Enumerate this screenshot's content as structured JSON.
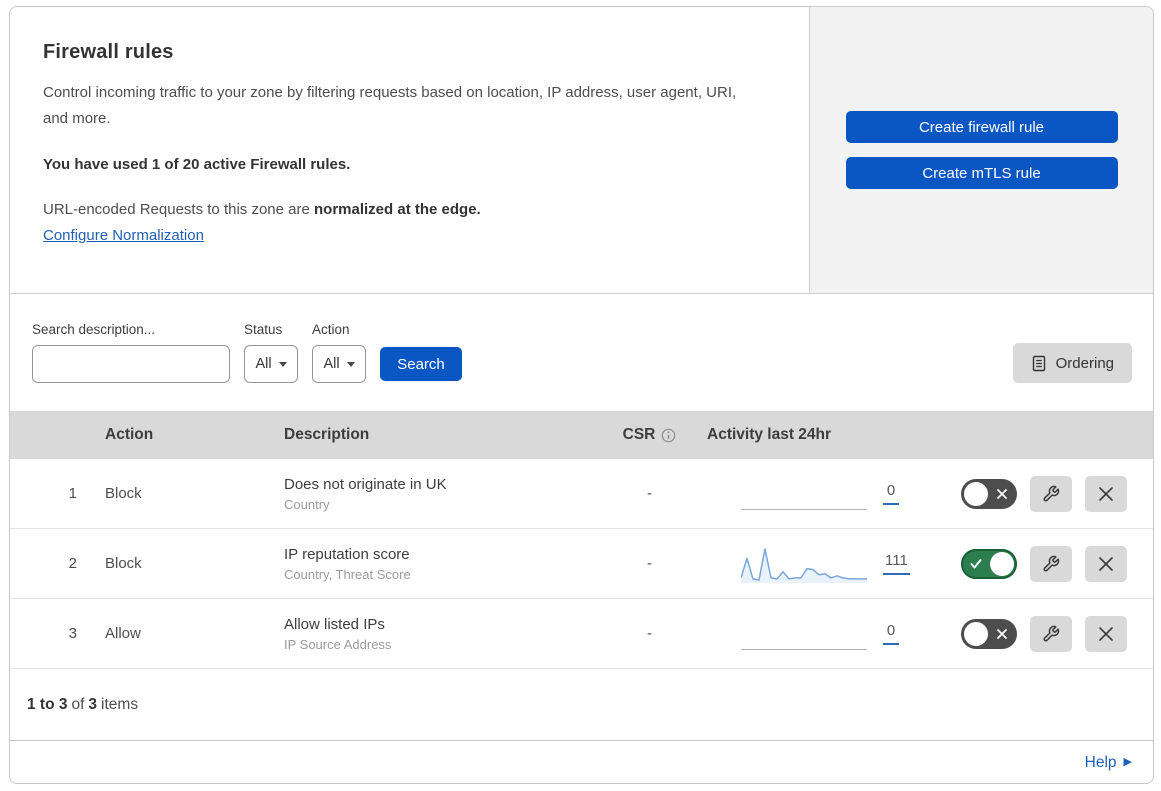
{
  "header": {
    "title": "Firewall rules",
    "description": "Control incoming traffic to your zone by filtering requests based on location, IP address, user agent, URI, and more.",
    "usage": "You have used 1 of 20 active Firewall rules.",
    "normalization_text": "URL-encoded Requests to this zone are ",
    "normalization_bold": "normalized at the edge.",
    "normalization_link": "Configure Normalization",
    "buttons": {
      "create_firewall": "Create firewall rule",
      "create_mtls": "Create mTLS rule"
    }
  },
  "filters": {
    "search_label": "Search description...",
    "search_value": "",
    "status_label": "Status",
    "status_value": "All",
    "action_label": "Action",
    "action_value": "All",
    "search_button": "Search",
    "ordering_button": "Ordering"
  },
  "table": {
    "columns": {
      "action": "Action",
      "description": "Description",
      "csr": "CSR",
      "activity": "Activity last 24hr"
    },
    "rows": [
      {
        "priority": "1",
        "action": "Block",
        "description": "Does not originate in UK",
        "fields": "Country",
        "csr": "-",
        "activity_count": "0",
        "enabled": false,
        "sparkline": []
      },
      {
        "priority": "2",
        "action": "Block",
        "description": "IP reputation score",
        "fields": "Country, Threat Score",
        "csr": "-",
        "activity_count": "111",
        "enabled": true,
        "sparkline": [
          3,
          22,
          2,
          1,
          31,
          3,
          2,
          9,
          2,
          3,
          3,
          12,
          11,
          6,
          7,
          3,
          5,
          3,
          2,
          2,
          2,
          2
        ]
      },
      {
        "priority": "3",
        "action": "Allow",
        "description": "Allow listed IPs",
        "fields": "IP Source Address",
        "csr": "-",
        "activity_count": "0",
        "enabled": false,
        "sparkline": []
      }
    ]
  },
  "footer": {
    "range": "1 to 3",
    "of": "of",
    "total": "3",
    "items": "items",
    "help": "Help"
  },
  "icons": {
    "search": "magnifier",
    "ordering": "list-document",
    "csr_info": "info-circle",
    "status_caret": "caret-down",
    "action_caret": "caret-down",
    "toggle_on": "check",
    "toggle_off": "x",
    "edit": "wrench",
    "delete": "x",
    "help": "right-triangle"
  },
  "colors": {
    "accent_blue": "#0a57c4",
    "link_blue": "#2160b4",
    "toggle_on_green": "#2c7e4f",
    "toggle_off_gray": "#4d4d4d",
    "spark_line": "#79a6dd",
    "spark_fill": "rgba(121,166,221,0.16)",
    "table_header_bg": "#d9d9d9",
    "panel_bg": "#f2f2f2"
  }
}
